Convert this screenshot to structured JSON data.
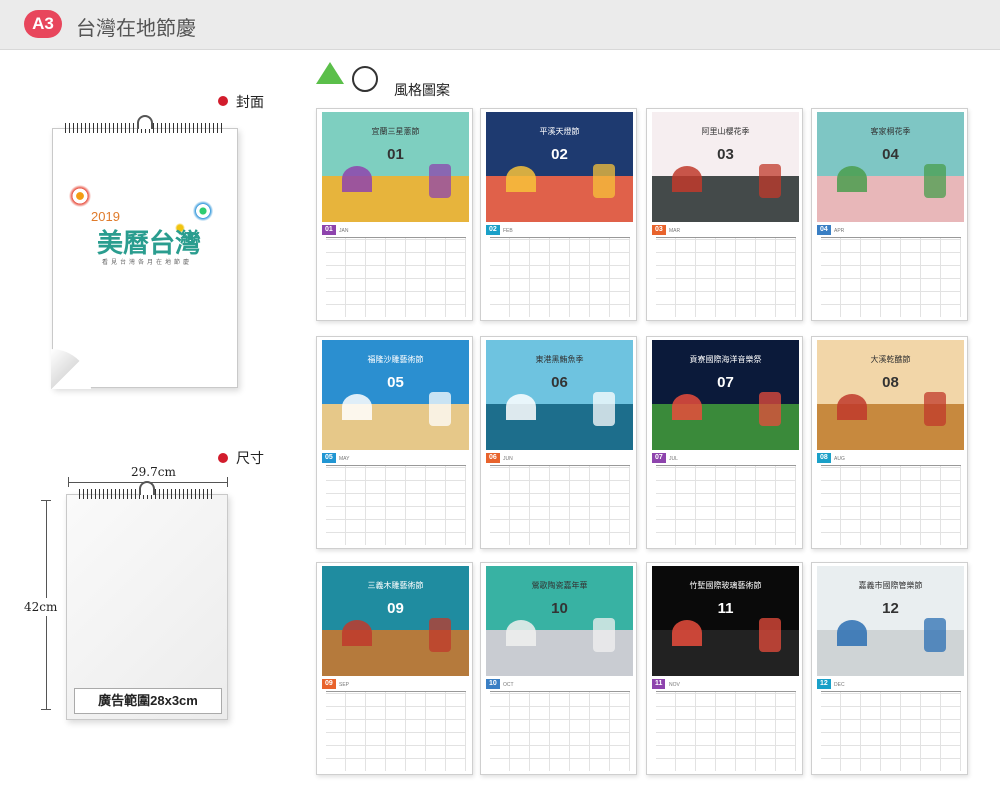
{
  "header": {
    "badge": "A3",
    "title": "台灣在地節慶"
  },
  "labels": {
    "cover": "封面",
    "size": "尺寸",
    "style": "風格圖案"
  },
  "cover": {
    "year": "2019",
    "title": "美曆台灣",
    "subtitle": "看見台灣各月在地節慶"
  },
  "dimensions": {
    "width": "29.7cm",
    "height": "42cm",
    "ad_area": "廣告範圍28x3cm"
  },
  "months": [
    {
      "num": "01",
      "name": "JAN",
      "title": "宜蘭三星蔥節",
      "sky": "#7ecfc0",
      "ground": "#e7b43c",
      "accent": "#8e44ad",
      "tab": "#8e44ad"
    },
    {
      "num": "02",
      "name": "FEB",
      "title": "平溪天燈節",
      "sky": "#1e3a70",
      "ground": "#e0614a",
      "accent": "#f7c23a",
      "tab": "#1aa0c8"
    },
    {
      "num": "03",
      "name": "MAR",
      "title": "阿里山櫻花季",
      "sky": "#f6eef0",
      "ground": "#444a4a",
      "accent": "#c0392b",
      "tab": "#e8632c"
    },
    {
      "num": "04",
      "name": "APR",
      "title": "客家桐花季",
      "sky": "#7ec6c4",
      "ground": "#e8b7b9",
      "accent": "#4a9d4e",
      "tab": "#3a7fc4"
    },
    {
      "num": "05",
      "name": "MAY",
      "title": "福隆沙雕藝術節",
      "sky": "#2b8fd0",
      "ground": "#e6c889",
      "accent": "#ffffff",
      "tab": "#2196d3"
    },
    {
      "num": "06",
      "name": "JUN",
      "title": "東港黑鮪魚季",
      "sky": "#6ec3e0",
      "ground": "#1d6e8c",
      "accent": "#ffffff",
      "tab": "#e8632c"
    },
    {
      "num": "07",
      "name": "JUL",
      "title": "貢寮國際海洋音樂祭",
      "sky": "#0b1a3a",
      "ground": "#3a8a3a",
      "accent": "#e74c3c",
      "tab": "#8e44ad"
    },
    {
      "num": "08",
      "name": "AUG",
      "title": "大溪乾醮節",
      "sky": "#f2d6a8",
      "ground": "#c7893e",
      "accent": "#c0392b",
      "tab": "#1aa0c8"
    },
    {
      "num": "09",
      "name": "SEP",
      "title": "三義木雕藝術節",
      "sky": "#1f8ca0",
      "ground": "#b57a3c",
      "accent": "#c0392b",
      "tab": "#e8632c"
    },
    {
      "num": "10",
      "name": "OCT",
      "title": "鶯歌陶瓷嘉年華",
      "sky": "#38b2a3",
      "ground": "#c9ccd2",
      "accent": "#f0f0f0",
      "tab": "#3a7fc4"
    },
    {
      "num": "11",
      "name": "NOV",
      "title": "竹塹國際玻璃藝術節",
      "sky": "#0a0a0a",
      "ground": "#222222",
      "accent": "#e74c3c",
      "tab": "#8e44ad"
    },
    {
      "num": "12",
      "name": "DEC",
      "title": "嘉義市國際管樂節",
      "sky": "#e9eef0",
      "ground": "#cfd4d6",
      "accent": "#2b6fb3",
      "tab": "#1aa0c8"
    }
  ]
}
